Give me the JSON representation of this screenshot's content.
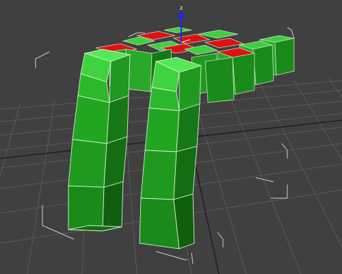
{
  "viewport": {
    "background": "#404040",
    "grid_color": "#5a5a5a",
    "grid_major_color": "#202020",
    "wire_color": "#d8e8d0",
    "bracket_color": "#d0d0d0",
    "colors": {
      "green_light": "#3fd43f",
      "green_mid": "#1f9a1f",
      "green_dark": "#136e13",
      "green_top": "#56e856",
      "red_face": "#e01010"
    },
    "gizmo": {
      "axis_label": "z",
      "axis_color": "#2020ff",
      "icon": "transform-gizmo-icon"
    }
  }
}
